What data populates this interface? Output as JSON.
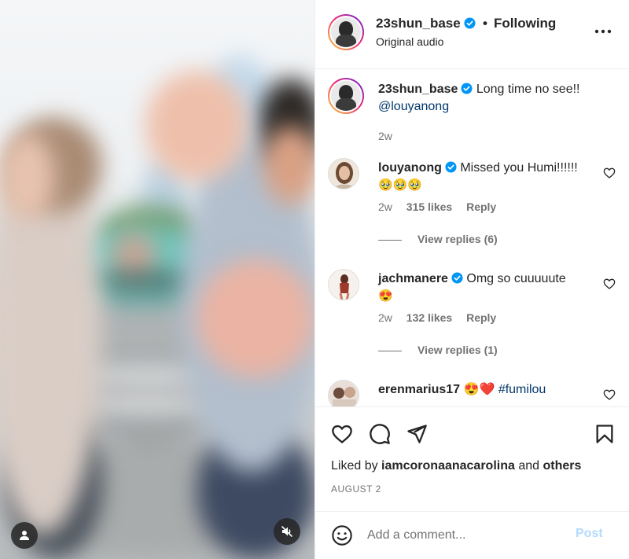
{
  "header": {
    "username": "23shun_base",
    "separator": "•",
    "following_label": "Following",
    "audio": "Original audio",
    "more_icon": "more-horizontal-icon"
  },
  "caption": {
    "username": "23shun_base",
    "text": "Long time no see!!",
    "mention": "@louyanong",
    "time": "2w"
  },
  "comments": [
    {
      "username": "louyanong",
      "verified": true,
      "text": "Missed you Humi!!!!!!",
      "emoji": "🥹🥹🥹",
      "time": "2w",
      "likes": "315 likes",
      "reply": "Reply",
      "view_replies": "View replies (6)"
    },
    {
      "username": "jachmanere",
      "verified": true,
      "text": "Omg so cuuuuute",
      "emoji": "😍",
      "time": "2w",
      "likes": "132 likes",
      "reply": "Reply",
      "view_replies": "View replies (1)"
    },
    {
      "username": "erenmarius17",
      "verified": false,
      "emoji": "😍❤️",
      "hashtag": "#fumilou"
    }
  ],
  "likes": {
    "prefix": "Liked by",
    "user": "iamcoronaanacarolina",
    "and": "and",
    "others": "others"
  },
  "date": "AUGUST 2",
  "composer": {
    "placeholder": "Add a comment...",
    "post_label": "Post"
  },
  "colors": {
    "verified": "#0095f6",
    "link": "#00376b",
    "post_disabled": "#b3dbff",
    "secondary_text": "#737373"
  }
}
